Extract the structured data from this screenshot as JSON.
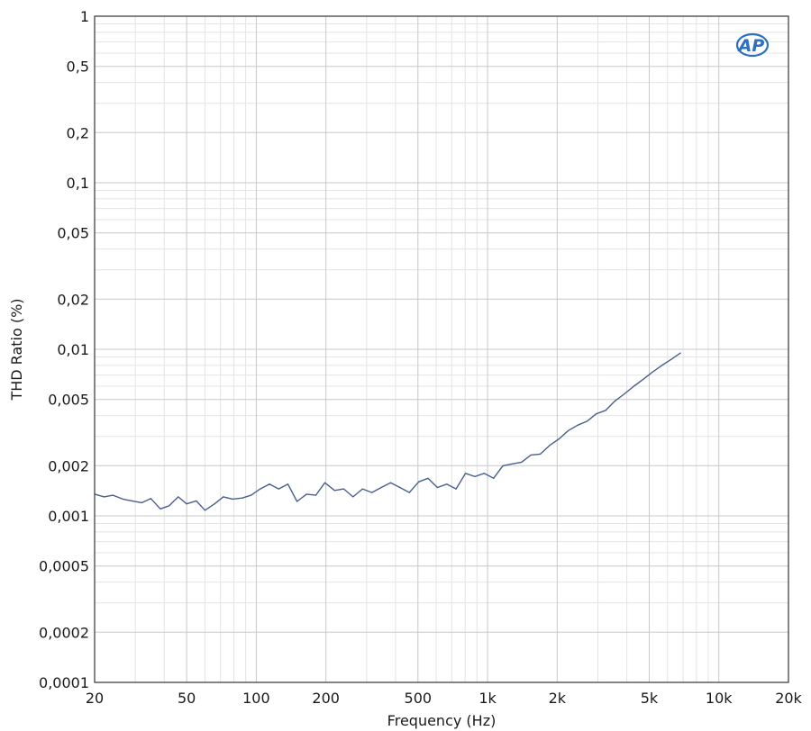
{
  "chart_data": {
    "type": "line",
    "title": "",
    "xlabel": "Frequency (Hz)",
    "ylabel": "THD Ratio (%)",
    "xscale": "log",
    "yscale": "log",
    "xlim": [
      20,
      20000
    ],
    "ylim": [
      0.0001,
      1
    ],
    "grid": true,
    "x_ticks": [
      {
        "value": 20,
        "label": "20"
      },
      {
        "value": 50,
        "label": "50"
      },
      {
        "value": 100,
        "label": "100"
      },
      {
        "value": 200,
        "label": "200"
      },
      {
        "value": 500,
        "label": "500"
      },
      {
        "value": 1000,
        "label": "1k"
      },
      {
        "value": 2000,
        "label": "2k"
      },
      {
        "value": 5000,
        "label": "5k"
      },
      {
        "value": 10000,
        "label": "10k"
      },
      {
        "value": 20000,
        "label": "20k"
      }
    ],
    "y_ticks": [
      {
        "value": 1,
        "label": "1"
      },
      {
        "value": 0.5,
        "label": "0,5"
      },
      {
        "value": 0.2,
        "label": "0,2"
      },
      {
        "value": 0.1,
        "label": "0,1"
      },
      {
        "value": 0.05,
        "label": "0,05"
      },
      {
        "value": 0.02,
        "label": "0,02"
      },
      {
        "value": 0.01,
        "label": "0,01"
      },
      {
        "value": 0.005,
        "label": "0,005"
      },
      {
        "value": 0.002,
        "label": "0,002"
      },
      {
        "value": 0.001,
        "label": "0,001"
      },
      {
        "value": 0.0005,
        "label": "0,0005"
      },
      {
        "value": 0.0002,
        "label": "0,0002"
      },
      {
        "value": 0.0001,
        "label": "0,0001"
      }
    ],
    "series": [
      {
        "color": "#4a5f8c",
        "points": [
          [
            20,
            0.00135
          ],
          [
            22,
            0.0013
          ],
          [
            24,
            0.00133
          ],
          [
            26.5,
            0.00126
          ],
          [
            29,
            0.00123
          ],
          [
            32,
            0.0012
          ],
          [
            35,
            0.00127
          ],
          [
            38.5,
            0.0011
          ],
          [
            42,
            0.00115
          ],
          [
            46,
            0.0013
          ],
          [
            50,
            0.00118
          ],
          [
            55,
            0.00123
          ],
          [
            60,
            0.00108
          ],
          [
            66,
            0.00118
          ],
          [
            72,
            0.0013
          ],
          [
            79,
            0.00126
          ],
          [
            87,
            0.00128
          ],
          [
            95,
            0.00133
          ],
          [
            104,
            0.00145
          ],
          [
            114,
            0.00155
          ],
          [
            125,
            0.00145
          ],
          [
            137,
            0.00155
          ],
          [
            150,
            0.00122
          ],
          [
            165,
            0.00135
          ],
          [
            181,
            0.00133
          ],
          [
            198,
            0.00158
          ],
          [
            218,
            0.00142
          ],
          [
            239,
            0.00145
          ],
          [
            262,
            0.0013
          ],
          [
            288,
            0.00145
          ],
          [
            316,
            0.00138
          ],
          [
            347,
            0.00148
          ],
          [
            381,
            0.00158
          ],
          [
            418,
            0.00148
          ],
          [
            459,
            0.00138
          ],
          [
            504,
            0.0016
          ],
          [
            553,
            0.00168
          ],
          [
            607,
            0.00148
          ],
          [
            666,
            0.00155
          ],
          [
            731,
            0.00145
          ],
          [
            803,
            0.0018
          ],
          [
            881,
            0.00172
          ],
          [
            967,
            0.0018
          ],
          [
            1061,
            0.00168
          ],
          [
            1165,
            0.002
          ],
          [
            1279,
            0.00205
          ],
          [
            1403,
            0.0021
          ],
          [
            1540,
            0.00232
          ],
          [
            1691,
            0.00235
          ],
          [
            1856,
            0.00265
          ],
          [
            2037,
            0.0029
          ],
          [
            2235,
            0.00325
          ],
          [
            2453,
            0.0035
          ],
          [
            2693,
            0.0037
          ],
          [
            2955,
            0.0041
          ],
          [
            3244,
            0.0043
          ],
          [
            3560,
            0.0049
          ],
          [
            3907,
            0.0054
          ],
          [
            4289,
            0.006
          ],
          [
            4707,
            0.0066
          ],
          [
            5166,
            0.0073
          ],
          [
            5670,
            0.008
          ],
          [
            6223,
            0.0087
          ],
          [
            6830,
            0.0095
          ]
        ]
      }
    ]
  },
  "logo": {
    "text": "AP",
    "color": "#2e6fc0"
  }
}
